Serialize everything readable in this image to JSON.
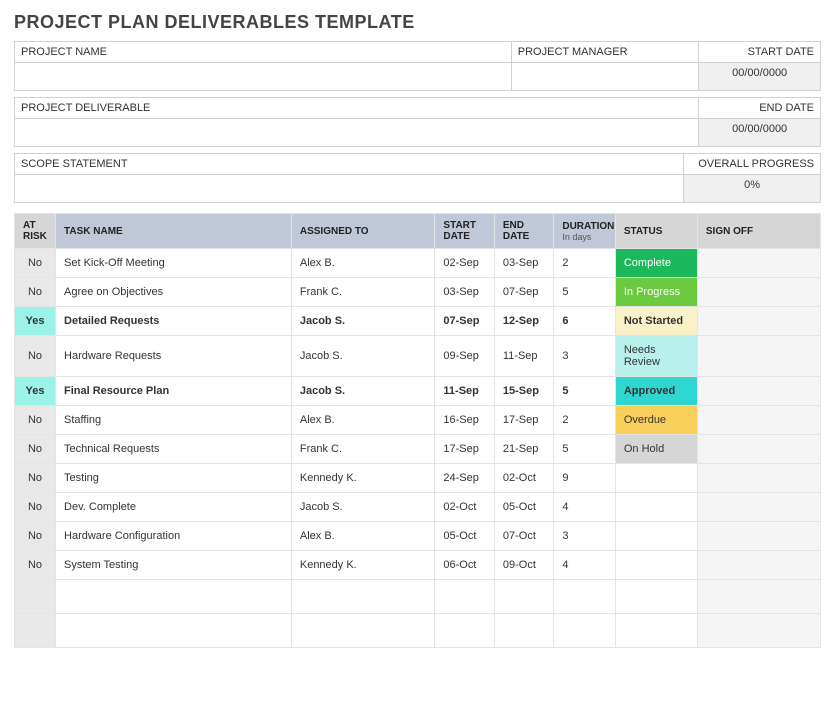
{
  "title": "PROJECT PLAN DELIVERABLES TEMPLATE",
  "meta": {
    "labels": {
      "project_name": "PROJECT NAME",
      "project_manager": "PROJECT MANAGER",
      "start_date": "START DATE",
      "project_deliverable": "PROJECT DELIVERABLE",
      "end_date": "END DATE",
      "scope_statement": "SCOPE STATEMENT",
      "overall_progress": "OVERALL PROGRESS"
    },
    "values": {
      "project_name": "",
      "project_manager": "",
      "start_date": "00/00/0000",
      "project_deliverable": "",
      "end_date": "00/00/0000",
      "scope_statement": "",
      "overall_progress": "0%"
    }
  },
  "columns": {
    "at_risk": "AT RISK",
    "task_name": "TASK NAME",
    "assigned_to": "ASSIGNED TO",
    "start_date": "START DATE",
    "end_date": "END DATE",
    "duration": "DURATION",
    "duration_sub": "In days",
    "status": "STATUS",
    "sign_off": "SIGN OFF"
  },
  "rows": [
    {
      "risk": "No",
      "task": "Set Kick-Off Meeting",
      "assigned": "Alex B.",
      "start": "02-Sep",
      "end": "03-Sep",
      "dur": "2",
      "status": "Complete",
      "status_class": "st-complete",
      "bold": false
    },
    {
      "risk": "No",
      "task": "Agree on Objectives",
      "assigned": "Frank C.",
      "start": "03-Sep",
      "end": "07-Sep",
      "dur": "5",
      "status": "In Progress",
      "status_class": "st-inprogress",
      "bold": false
    },
    {
      "risk": "Yes",
      "task": "Detailed Requests",
      "assigned": "Jacob S.",
      "start": "07-Sep",
      "end": "12-Sep",
      "dur": "6",
      "status": "Not Started",
      "status_class": "st-notstarted",
      "bold": true
    },
    {
      "risk": "No",
      "task": "Hardware Requests",
      "assigned": "Jacob S.",
      "start": "09-Sep",
      "end": "11-Sep",
      "dur": "3",
      "status": "Needs Review",
      "status_class": "st-needsreview",
      "bold": false
    },
    {
      "risk": "Yes",
      "task": "Final Resource Plan",
      "assigned": "Jacob S.",
      "start": "11-Sep",
      "end": "15-Sep",
      "dur": "5",
      "status": "Approved",
      "status_class": "st-approved",
      "bold": true
    },
    {
      "risk": "No",
      "task": "Staffing",
      "assigned": "Alex B.",
      "start": "16-Sep",
      "end": "17-Sep",
      "dur": "2",
      "status": "Overdue",
      "status_class": "st-overdue",
      "bold": false
    },
    {
      "risk": "No",
      "task": "Technical Requests",
      "assigned": "Frank C.",
      "start": "17-Sep",
      "end": "21-Sep",
      "dur": "5",
      "status": "On Hold",
      "status_class": "st-onhold",
      "bold": false
    },
    {
      "risk": "No",
      "task": "Testing",
      "assigned": "Kennedy K.",
      "start": "24-Sep",
      "end": "02-Oct",
      "dur": "9",
      "status": "",
      "status_class": "",
      "bold": false
    },
    {
      "risk": "No",
      "task": "Dev. Complete",
      "assigned": "Jacob S.",
      "start": "02-Oct",
      "end": "05-Oct",
      "dur": "4",
      "status": "",
      "status_class": "",
      "bold": false
    },
    {
      "risk": "No",
      "task": "Hardware Configuration",
      "assigned": "Alex B.",
      "start": "05-Oct",
      "end": "07-Oct",
      "dur": "3",
      "status": "",
      "status_class": "",
      "bold": false
    },
    {
      "risk": "No",
      "task": "System Testing",
      "assigned": "Kennedy K.",
      "start": "06-Oct",
      "end": "09-Oct",
      "dur": "4",
      "status": "",
      "status_class": "",
      "bold": false
    }
  ],
  "empty_rows": 2
}
